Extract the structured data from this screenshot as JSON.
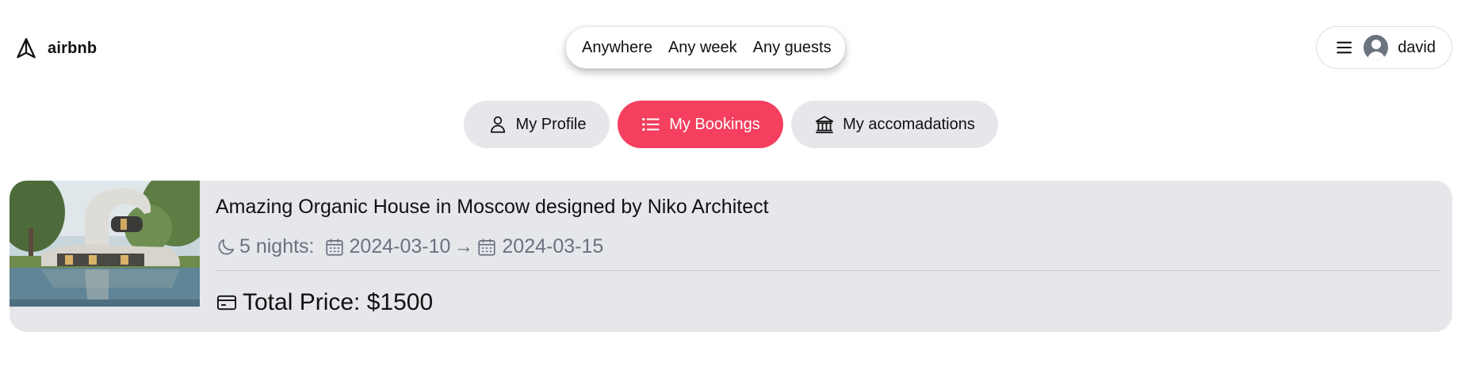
{
  "brand": {
    "name": "airbnb",
    "accent": "#f43f5e"
  },
  "search": {
    "where": "Anywhere",
    "when": "Any week",
    "who": "Any guests"
  },
  "user": {
    "name": "david"
  },
  "tabs": [
    {
      "label": "My Profile",
      "icon": "user-icon",
      "active": false
    },
    {
      "label": "My Bookings",
      "icon": "list-icon",
      "active": true
    },
    {
      "label": "My accomadations",
      "icon": "building-icon",
      "active": false
    }
  ],
  "booking": {
    "title": "Amazing Organic House in Moscow designed by Niko Architect",
    "nights": "5 nights:",
    "check_in": "2024-03-10",
    "arrow": "→",
    "check_out": "2024-03-15",
    "total_price": "Total Price: $1500",
    "photo": "organic-house-photo"
  }
}
